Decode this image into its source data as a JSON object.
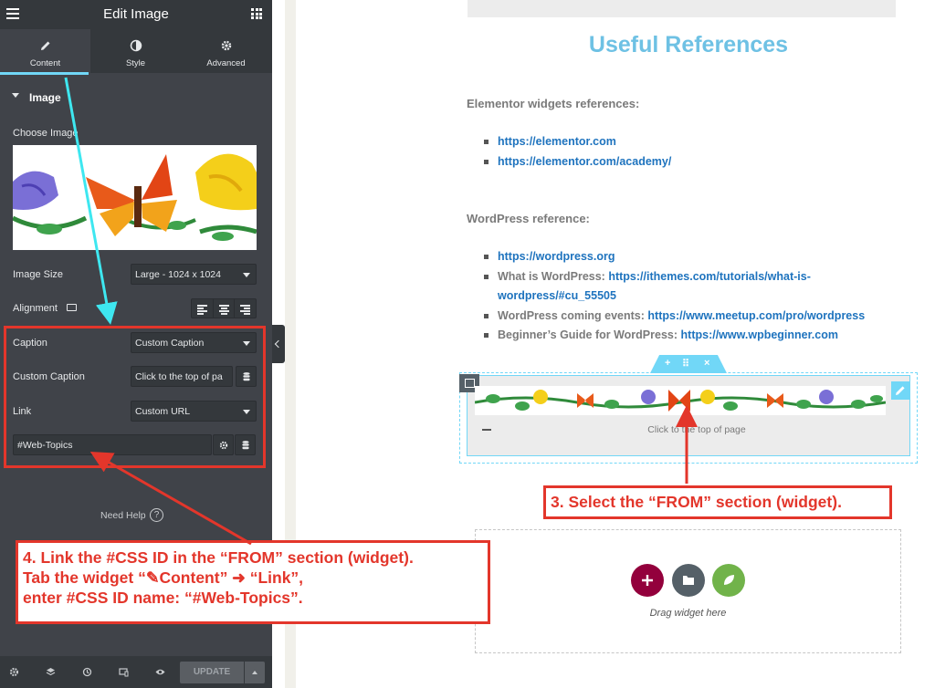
{
  "panel": {
    "title": "Edit Image",
    "tabs": [
      {
        "label": "Content",
        "icon": "pencil-icon",
        "active": true
      },
      {
        "label": "Style",
        "icon": "half-circle-icon",
        "active": false
      },
      {
        "label": "Advanced",
        "icon": "gear-icon",
        "active": false
      }
    ],
    "section_title": "Image",
    "choose_image_label": "Choose Image",
    "image_size_label": "Image Size",
    "image_size_value": "Large - 1024 x 1024",
    "alignment_label": "Alignment",
    "caption_label": "Caption",
    "caption_value": "Custom Caption",
    "custom_caption_label": "Custom Caption",
    "custom_caption_value": "Click to the top of pa",
    "link_label": "Link",
    "link_value": "Custom URL",
    "link_url_value": "#Web-Topics",
    "need_help": "Need Help",
    "help_icon": "?",
    "update_label": "UPDATE",
    "accent_color": "#71d7f7"
  },
  "canvas": {
    "heading": "Useful References",
    "elementor_title": "Elementor widgets references:",
    "elementor_links": [
      {
        "text": "https://elementor.com"
      },
      {
        "text": "https://elementor.com/academy/"
      }
    ],
    "wordpress_title": "WordPress reference:",
    "wp_item1": "https://wordpress.org",
    "wp_item2_prefix": "What is WordPress: ",
    "wp_item2_link_line1": "https://ithemes.com/tutorials/what-is-",
    "wp_item2_link_line2": "wordpress/#cu_55505",
    "wp_item3_prefix": "WordPress coming events: ",
    "wp_item3_link": "https://www.meetup.com/pro/wordpress",
    "wp_item4_prefix": "Beginner’s Guide for WordPress: ",
    "wp_item4_link": "https://www.wpbeginner.com",
    "section_handle": {
      "add": "+",
      "move": "⠿",
      "close": "×"
    },
    "widget_caption": "Click to the top of page",
    "drop_text": "Drag widget here",
    "link_color": "#1e73be",
    "heading_color": "#6ec1e4"
  },
  "annotations": {
    "callout_3": "3. Select the “FROM” section (widget).",
    "callout_4_line1": "4. Link the #CSS ID in the “FROM” section (widget).",
    "callout_4_line2": "Tab the widget “✎Content” ➜ “Link”,",
    "callout_4_line3": "enter #CSS ID name: “#Web-Topics”.",
    "highlight_color": "#e3362b",
    "arrow_color": "#3ee7f0"
  }
}
